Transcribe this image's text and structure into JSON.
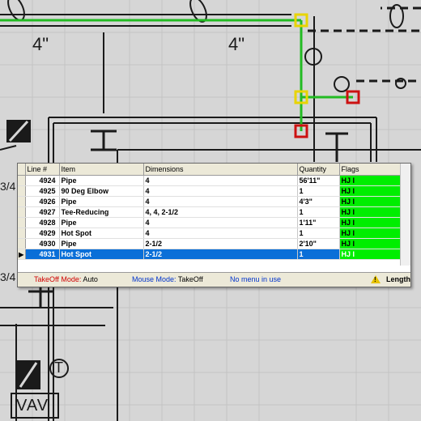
{
  "drawing": {
    "labels": [
      "4\"",
      "4\"",
      "VAV",
      "T",
      "3/4",
      "3/4"
    ]
  },
  "takeoff": {
    "columns": [
      "Line #",
      "Item",
      "Dimensions",
      "Quantity",
      "Flags"
    ],
    "rows": [
      {
        "line": "4924",
        "item": "Pipe",
        "dimensions": "4",
        "quantity": "56'11\"",
        "flags": "HJ I"
      },
      {
        "line": "4925",
        "item": "90 Deg Elbow",
        "dimensions": "4",
        "quantity": "1",
        "flags": "HJ I"
      },
      {
        "line": "4926",
        "item": "Pipe",
        "dimensions": "4",
        "quantity": "4'3\"",
        "flags": "HJ I"
      },
      {
        "line": "4927",
        "item": "Tee-Reducing",
        "dimensions": "4, 4, 2-1/2",
        "quantity": "1",
        "flags": "HJ I"
      },
      {
        "line": "4928",
        "item": "Pipe",
        "dimensions": "4",
        "quantity": "1'11\"",
        "flags": "HJ I"
      },
      {
        "line": "4929",
        "item": "Hot Spot",
        "dimensions": "4",
        "quantity": "1",
        "flags": "HJ I"
      },
      {
        "line": "4930",
        "item": "Pipe",
        "dimensions": "2-1/2",
        "quantity": "2'10\"",
        "flags": "HJ I"
      },
      {
        "line": "4931",
        "item": "Hot Spot",
        "dimensions": "2-1/2",
        "quantity": "1",
        "flags": "HJ I"
      }
    ],
    "selected_row": "4931",
    "flag_color": "#00ee00",
    "selection_color": "#0a6fd8"
  },
  "status_bar": {
    "takeoff_mode_label": "TakeOff Mode:",
    "takeoff_mode_value": "Auto",
    "mouse_mode_label": "Mouse Mode:",
    "mouse_mode_value": "TakeOff",
    "menu_message": "No menu in use",
    "length_label": "Length",
    "warning_icon": "warning-icon"
  },
  "colors": {
    "pipe_run": "#22bb22",
    "node_yellow": "#e8d400",
    "node_red": "#cc1111",
    "drawing_lines": "#1a1a1a",
    "background": "#d6d6d6"
  }
}
